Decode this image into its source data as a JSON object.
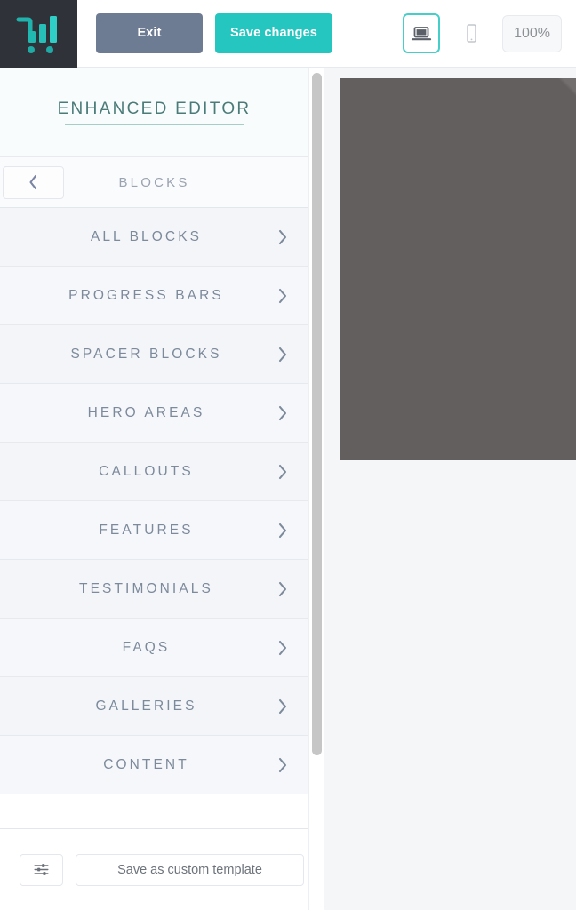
{
  "topbar": {
    "logo_icon": "cart-bars-logo-icon",
    "exit_label": "Exit",
    "save_label": "Save changes",
    "desktop_icon": "laptop-icon",
    "mobile_icon": "mobile-phone-icon",
    "zoom_label": "100%"
  },
  "sidebar": {
    "editor_title": "ENHANCED EDITOR",
    "back_icon": "chevron-left-icon",
    "panel_title": "BLOCKS",
    "items": [
      {
        "label": "ALL BLOCKS",
        "chevron": "chevron-right-icon"
      },
      {
        "label": "PROGRESS BARS",
        "chevron": "chevron-right-icon"
      },
      {
        "label": "SPACER BLOCKS",
        "chevron": "chevron-right-icon"
      },
      {
        "label": "HERO AREAS",
        "chevron": "chevron-right-icon"
      },
      {
        "label": "CALLOUTS",
        "chevron": "chevron-right-icon"
      },
      {
        "label": "FEATURES",
        "chevron": "chevron-right-icon"
      },
      {
        "label": "TESTIMONIALS",
        "chevron": "chevron-right-icon"
      },
      {
        "label": "FAQS",
        "chevron": "chevron-right-icon"
      },
      {
        "label": "GALLERIES",
        "chevron": "chevron-right-icon"
      },
      {
        "label": "CONTENT",
        "chevron": "chevron-right-icon"
      }
    ],
    "scrollbar": "vertical-scrollbar"
  },
  "footer": {
    "settings_icon": "sliders-icon",
    "save_template_label": "Save as custom template"
  },
  "preview": {
    "hero_block": "hero-image-placeholder"
  },
  "colors": {
    "brand_teal": "#26c6c0",
    "exit_slate": "#6d7b93",
    "logo_bg": "#2f3339",
    "title_teal": "#4b7b78",
    "row_text": "#7c8a9c",
    "hero_grey": "#645f5f",
    "active_border": "#46cfca"
  }
}
